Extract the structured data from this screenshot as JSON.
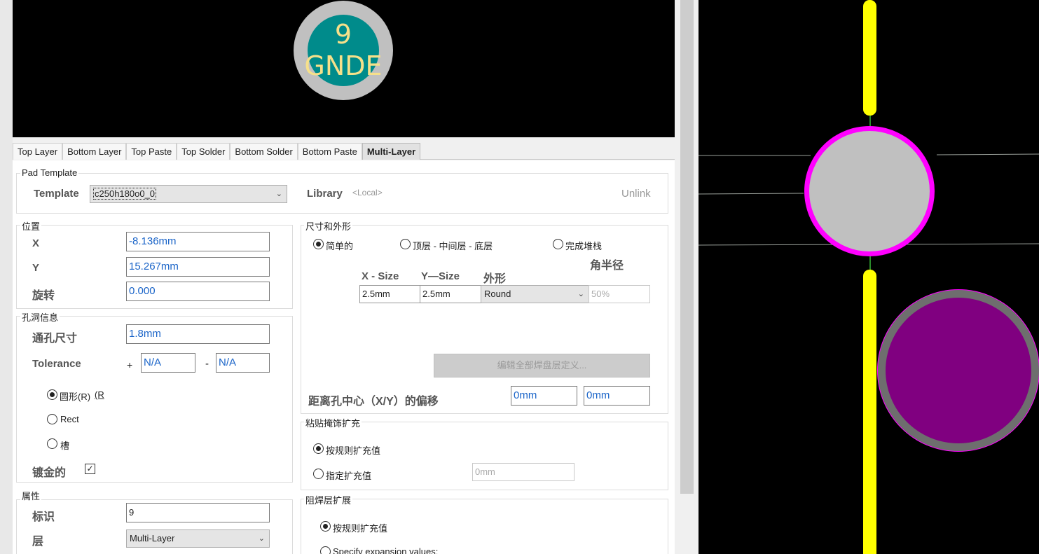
{
  "preview": {
    "pad_number": "9",
    "pad_net": "GNDE"
  },
  "tabs": [
    {
      "label": "Top Layer",
      "active": false
    },
    {
      "label": "Bottom Layer",
      "active": false
    },
    {
      "label": "Top Paste",
      "active": false
    },
    {
      "label": "Top Solder",
      "active": false
    },
    {
      "label": "Bottom Solder",
      "active": false
    },
    {
      "label": "Bottom Paste",
      "active": false
    },
    {
      "label": "Multi-Layer",
      "active": true
    }
  ],
  "pad_template": {
    "title": "Pad Template",
    "template_label": "Template",
    "template_value": "c250h180o0_0",
    "library_label": "Library",
    "library_value": "<Local>",
    "unlink_label": "Unlink"
  },
  "position": {
    "title": "位置",
    "x_label": "X",
    "x_value": "-8.136mm",
    "y_label": "Y",
    "y_value": "15.267mm",
    "rotation_label": "旋转",
    "rotation_value": "0.000"
  },
  "hole": {
    "title": "孔洞信息",
    "size_label": "通孔尺寸",
    "size_value": "1.8mm",
    "tolerance_label": "Tolerance",
    "plus_sign": "+",
    "plus_value": "N/A",
    "minus_sign": "-",
    "minus_value": "N/A",
    "shape_round": "圆形(R)",
    "shape_round_accel": "(R",
    "shape_rect": "Rect",
    "shape_slot": "槽",
    "selected_shape": "round",
    "plated_label": "镀金的",
    "plated_checked": true
  },
  "properties": {
    "title": "属性",
    "designator_label": "标识",
    "designator_value": "9",
    "layer_label": "层",
    "layer_value": "Multi-Layer"
  },
  "size_shape": {
    "title": "尺寸和外形",
    "mode_simple": "简单的",
    "mode_top_mid_bottom": "顶层 - 中间层 - 底层",
    "mode_full_stack": "完成堆栈",
    "selected_mode": "simple",
    "x_size_header": "X - Size",
    "y_size_header": "Y—Size",
    "shape_header": "外形",
    "corner_header": "角半径",
    "x_size": "2.5mm",
    "y_size": "2.5mm",
    "shape": "Round",
    "corner_radius": "50%",
    "edit_all_button": "编辑全部焊盘层定义...",
    "offset_label": "距离孔中心（X/Y）的偏移",
    "offset_x": "0mm",
    "offset_y": "0mm"
  },
  "paste_mask": {
    "title": "粘贴掩饰扩充",
    "rule_option": "按规则扩充值",
    "specify_option": "指定扩充值",
    "specify_value": "0mm",
    "selected": "rule"
  },
  "solder_mask": {
    "title": "阻焊层扩展",
    "rule_option": "按规则扩充值",
    "specify_option": "Specify expansion values:",
    "selected": "rule"
  },
  "colors": {
    "preview_bg": "#000000",
    "pad_ring": "#c0c0c0",
    "pad_hole": "#008b8b",
    "track": "#ffff00",
    "selected_outline": "#ff00ff",
    "other_pad": "#800080",
    "value_text": "#1a64c8"
  }
}
